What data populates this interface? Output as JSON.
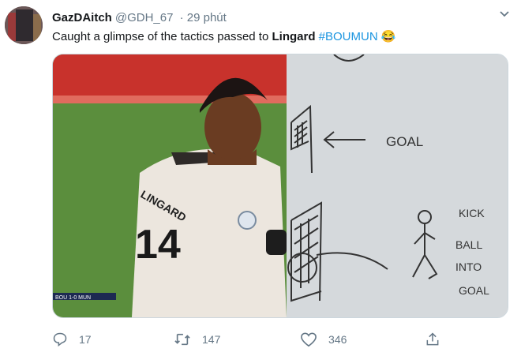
{
  "tweet": {
    "display_name": "GazDAitch",
    "handle": "@GDH_67",
    "time": "· 29 phút",
    "text_before": "Caught a glimpse of the tactics passed to ",
    "text_bold": "Lingard",
    "hashtag": "#BOUMUN",
    "emoji": "😂"
  },
  "media": {
    "jersey_name": "LINGARD",
    "jersey_number": "14",
    "scoreboard": "BOU 1-0 MUN",
    "drawing_labels": {
      "goal": "GOAL",
      "kick_1": "KICK",
      "kick_2": "BALL",
      "kick_3": "INTO",
      "kick_4": "GOAL"
    }
  },
  "actions": {
    "reply_count": "17",
    "retweet_count": "147",
    "like_count": "346"
  },
  "colors": {
    "link": "#1b95e0",
    "muted": "#657786"
  },
  "icons": [
    "chevron-down-icon",
    "reply-icon",
    "retweet-icon",
    "like-icon",
    "share-icon"
  ]
}
